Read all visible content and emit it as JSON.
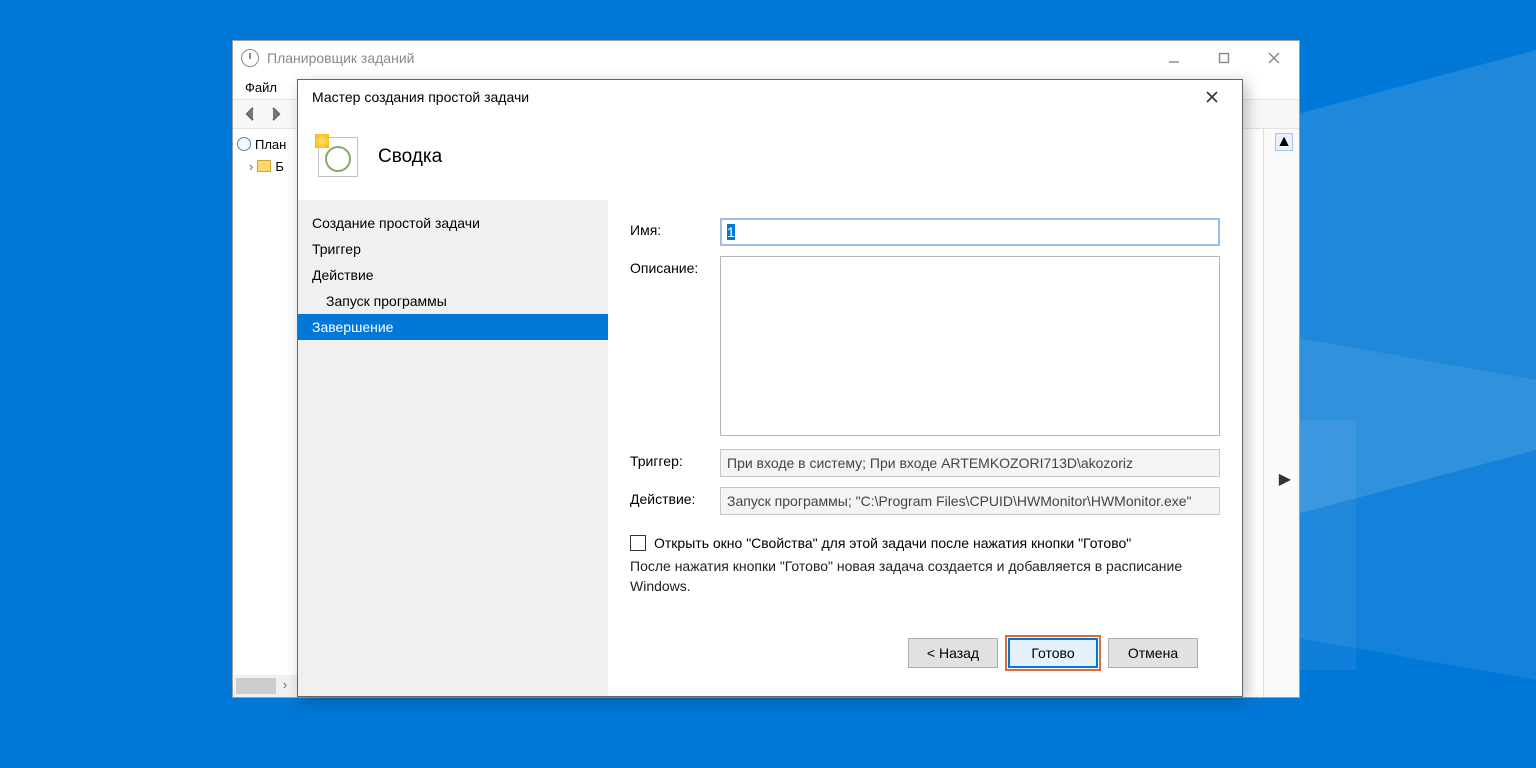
{
  "parent_window": {
    "title": "Планировщик заданий",
    "menu": {
      "file": "Файл"
    },
    "tree": {
      "root": "План",
      "child": "Б"
    }
  },
  "wizard": {
    "title": "Мастер создания простой задачи",
    "heading": "Сводка",
    "steps": {
      "s1": "Создание простой задачи",
      "s2": "Триггер",
      "s3": "Действие",
      "s4": "Запуск программы",
      "s5": "Завершение"
    },
    "labels": {
      "name": "Имя:",
      "description": "Описание:",
      "trigger": "Триггер:",
      "action": "Действие:"
    },
    "fields": {
      "name_value": "1",
      "description_value": "",
      "trigger_value": "При входе в систему; При входе ARTEMKOZORI713D\\akozoriz",
      "action_value": "Запуск программы; \"C:\\Program Files\\CPUID\\HWMonitor\\HWMonitor.exe\""
    },
    "checkbox_label": "Открыть окно \"Свойства\" для этой задачи после нажатия кнопки \"Готово\"",
    "info_text": "После нажатия кнопки \"Готово\" новая задача создается и добавляется в расписание Windows.",
    "buttons": {
      "back": "< Назад",
      "finish": "Готово",
      "cancel": "Отмена"
    }
  }
}
